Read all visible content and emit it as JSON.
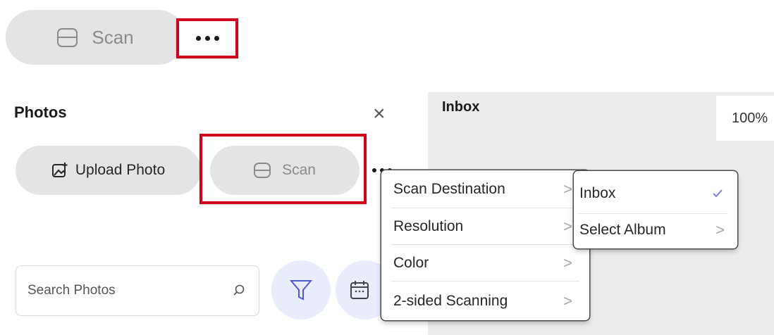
{
  "top": {
    "scan_label": "Scan"
  },
  "photos_panel": {
    "title": "Photos",
    "close_glyph": "×",
    "upload_label": "Upload Photo",
    "scan_label": "Scan",
    "search_placeholder": "Search Photos"
  },
  "inbox_panel": {
    "title": "Inbox",
    "zoom": "100%"
  },
  "scan_menu": {
    "items": [
      {
        "label": "Scan Destination"
      },
      {
        "label": "Resolution"
      },
      {
        "label": "Color"
      },
      {
        "label": "2-sided Scanning"
      }
    ]
  },
  "destination_submenu": {
    "items": [
      {
        "label": "Inbox",
        "selected": true
      },
      {
        "label": "Select Album"
      }
    ]
  },
  "colors": {
    "highlight": "#d0021b",
    "accent": "#5b63d8",
    "check": "#7a7fe6"
  },
  "icons": [
    "scan-icon",
    "more-icon",
    "close-icon",
    "upload-photo-icon",
    "search-icon",
    "filter-icon",
    "calendar-icon",
    "chevron-right-icon",
    "checkmark-icon"
  ]
}
